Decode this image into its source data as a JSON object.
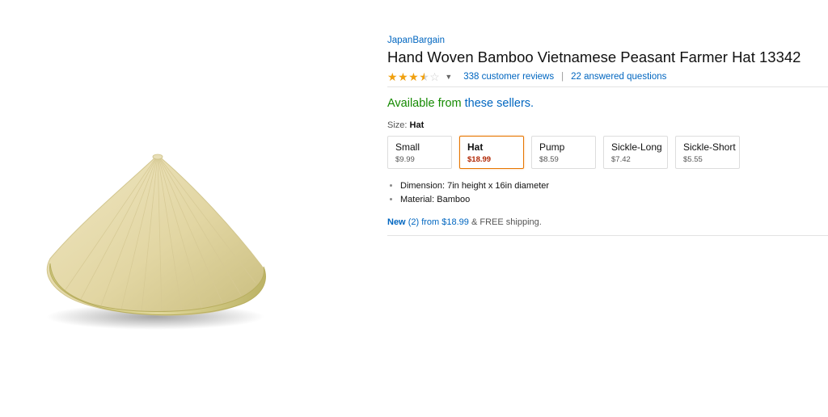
{
  "product": {
    "brand": "JapanBargain",
    "title": "Hand Woven Bamboo Vietnamese Peasant Farmer Hat 13342",
    "rating": 3.5,
    "reviews_text": "338 customer reviews",
    "separator": "|",
    "questions_text": "22 answered questions",
    "availability_prefix": "Available from ",
    "availability_link": "these sellers.",
    "size_label": "Size: ",
    "size_value": "Hat",
    "variants": [
      {
        "name": "Small",
        "price": "$9.99",
        "selected": false
      },
      {
        "name": "Hat",
        "price": "$18.99",
        "selected": true
      },
      {
        "name": "Pump",
        "price": "$8.59",
        "selected": false
      },
      {
        "name": "Sickle-Long",
        "price": "$7.42",
        "selected": false
      },
      {
        "name": "Sickle-Short",
        "price": "$5.55",
        "selected": false
      }
    ],
    "bullets": [
      "Dimension: 7in height x 16in diameter",
      "Material: Bamboo"
    ],
    "new_label": "New",
    "new_count": "(2)",
    "new_from": "from",
    "new_price": "$18.99",
    "new_suffix": "& FREE shipping."
  },
  "colors": {
    "link": "#0066c0",
    "availability": "#148a00",
    "price_selected": "#b12704",
    "star": "#f0a00f",
    "selected_border": "#e77600"
  }
}
